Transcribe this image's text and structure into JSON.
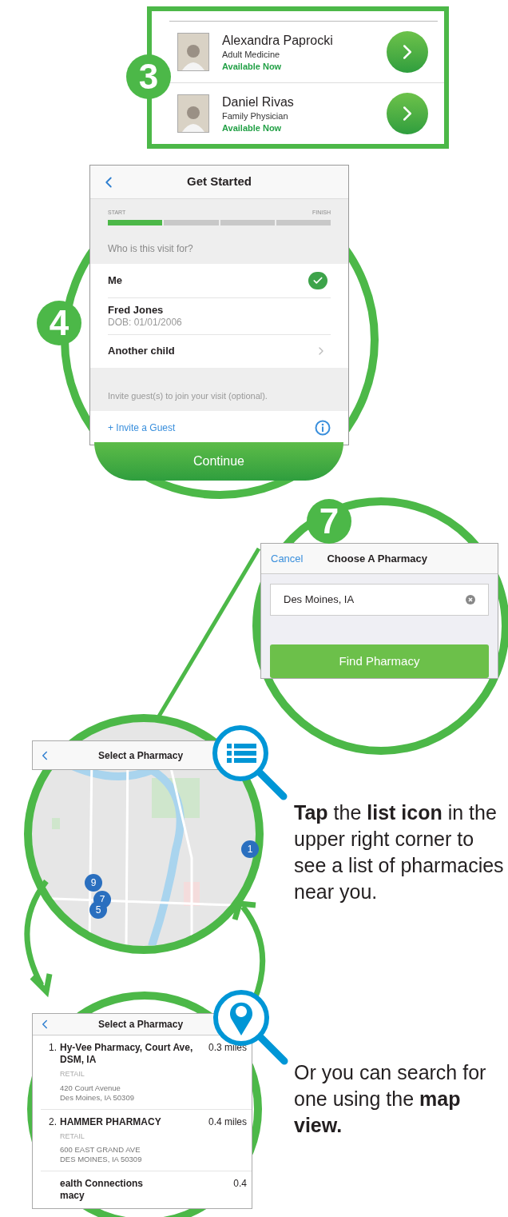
{
  "step_3": {
    "number": "3",
    "doctors": [
      {
        "name": "Alexandra Paprocki",
        "specialty": "Adult Medicine",
        "status": "Available Now"
      },
      {
        "name": "Daniel Rivas",
        "specialty": "Family Physician",
        "status": "Available Now"
      }
    ]
  },
  "step_4": {
    "number": "4",
    "title": "Get Started",
    "progress": {
      "start_label": "START",
      "finish_label": "FINISH",
      "level": 0.25
    },
    "question": "Who is this visit for?",
    "options": [
      {
        "kind": "person",
        "name": "Me",
        "selected": true
      },
      {
        "kind": "person",
        "name": "Fred Jones",
        "detail": "DOB: 01/01/2006",
        "selected": false
      },
      {
        "kind": "add",
        "name": "Another child",
        "selected": false
      }
    ],
    "guest_note": "Invite guest(s) to join your visit (optional).",
    "invite_link": "+ Invite a Guest",
    "button": "Continue"
  },
  "step_7": {
    "number": "7",
    "cancel": "Cancel",
    "title": "Choose A Pharmacy",
    "location_field": {
      "value": "Des Moines, IA"
    },
    "button": "Find Pharmacy"
  },
  "map_view": {
    "title": "Select a Pharmacy",
    "pins": [
      "9",
      "7",
      "5",
      "1"
    ],
    "caption": "**Tap** the **list icon** in the upper right corner to see a list of pharmacies near you."
  },
  "list_view": {
    "title": "Select a Pharmacy",
    "pharmacies": [
      {
        "number": "1.",
        "name": "Hy-Vee Pharmacy, Court Ave, DSM, IA",
        "distance": "0.3 miles",
        "type": "RETAIL",
        "address": [
          "420 Court Avenue",
          "Des Moines, IA 50309"
        ]
      },
      {
        "number": "2.",
        "name": "HAMMER PHARMACY",
        "distance": "0.4 miles",
        "type": "RETAIL",
        "address": [
          "600 EAST GRAND AVE",
          "DES MOINES, IA 50309"
        ]
      },
      {
        "name": "ealth Connections\nmacy",
        "distance": "0.4"
      }
    ],
    "caption": "Or you can search for one using the **map view.**"
  }
}
